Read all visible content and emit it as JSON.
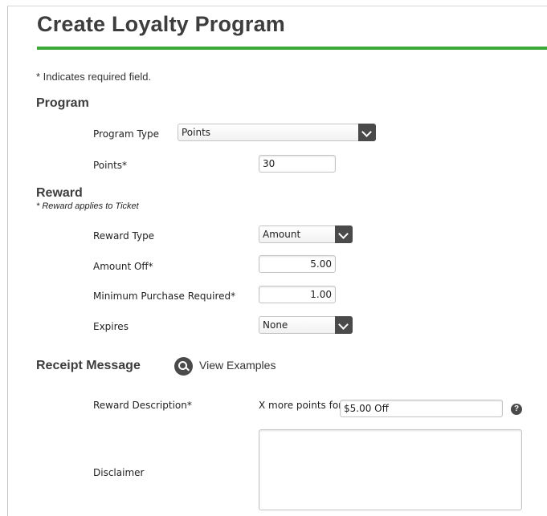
{
  "page": {
    "title": "Create Loyalty Program",
    "required_note": "* Indicates required field.",
    "accent_color": "#3aa935"
  },
  "program": {
    "heading": "Program",
    "type_label": "Program Type",
    "type_value": "Points",
    "points_label": "Points*",
    "points_value": "30"
  },
  "reward": {
    "heading": "Reward",
    "subnote": "* Reward applies to Ticket",
    "type_label": "Reward Type",
    "type_value": "Amount",
    "amount_off_label": "Amount Off*",
    "amount_off_value": "5.00",
    "min_purchase_label": "Minimum Purchase Required*",
    "min_purchase_value": "1.00",
    "expires_label": "Expires",
    "expires_value": "None"
  },
  "receipt": {
    "heading": "Receipt Message",
    "view_examples": "View Examples",
    "view_icon": "search-icon",
    "description_label": "Reward Description*",
    "description_prefix": "X more points for",
    "description_value": "$5.00 Off",
    "help_icon": "question-icon",
    "help_glyph": "?",
    "disclaimer_label": "Disclaimer",
    "disclaimer_value": ""
  }
}
